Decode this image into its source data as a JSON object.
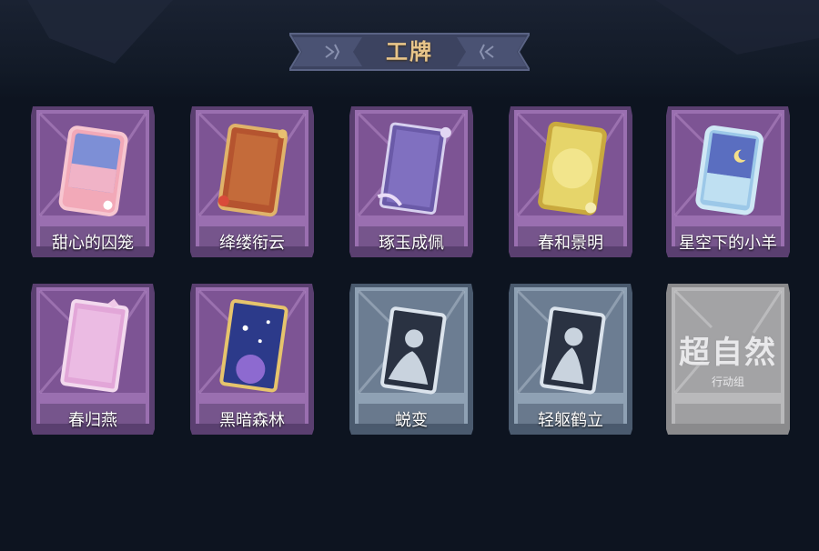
{
  "title": "工牌",
  "cards": [
    {
      "label": "甜心的囚笼",
      "theme": "purple"
    },
    {
      "label": "绛缕衔云",
      "theme": "purple"
    },
    {
      "label": "琢玉成佩",
      "theme": "purple"
    },
    {
      "label": "春和景明",
      "theme": "purple"
    },
    {
      "label": "星空下的小羊",
      "theme": "purple"
    },
    {
      "label": "春归燕",
      "theme": "purple"
    },
    {
      "label": "黑暗森林",
      "theme": "purple"
    },
    {
      "label": "蜕变",
      "theme": "blue"
    },
    {
      "label": "轻躯鹤立",
      "theme": "blue"
    },
    {
      "label": "",
      "theme": "gray",
      "logo_text": "超自然",
      "logo_subtext": "行动组"
    }
  ],
  "colors": {
    "background": "#0d1420",
    "title_text": "#e8c58a",
    "banner": "#3c4360",
    "purple_frame": "#9a6fb0",
    "blue_frame": "#8fa1b4",
    "gray_frame": "#b9b9bb"
  }
}
